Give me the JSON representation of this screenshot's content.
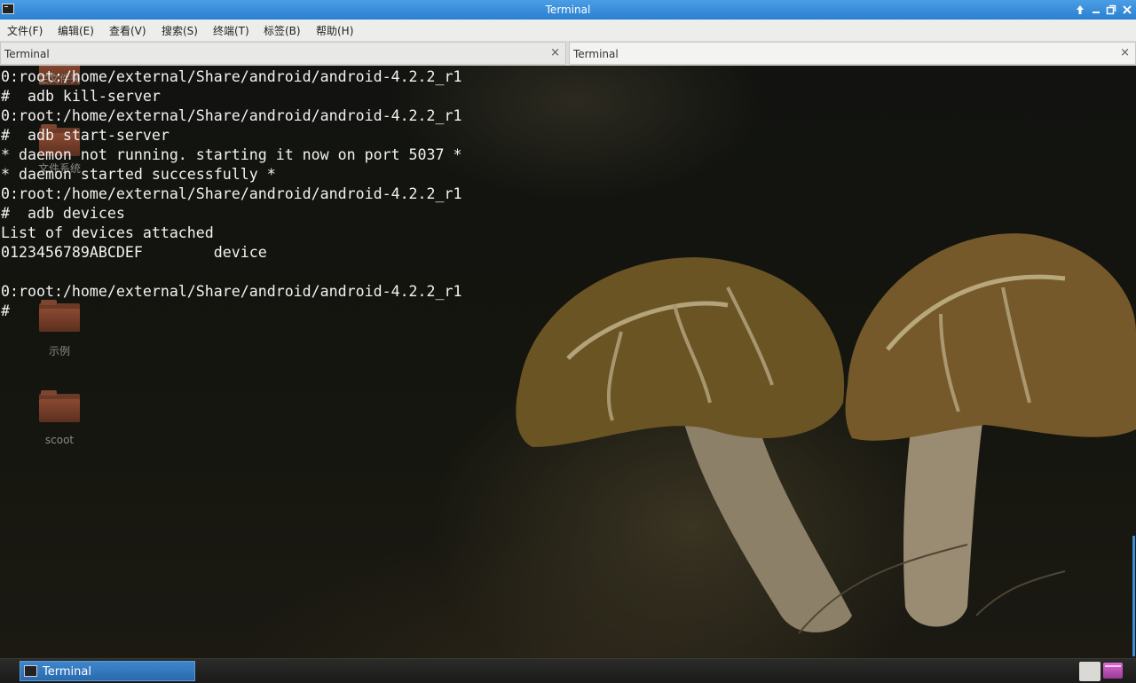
{
  "window": {
    "title": "Terminal"
  },
  "menu": {
    "items": [
      "文件(F)",
      "编辑(E)",
      "查看(V)",
      "搜索(S)",
      "终端(T)",
      "标签(B)",
      "帮助(H)"
    ]
  },
  "tabs": [
    {
      "label": "Terminal",
      "close": "×"
    },
    {
      "label": "Terminal",
      "close": "×"
    }
  ],
  "desktop": {
    "items": [
      {
        "label": "主文件夹",
        "icon": "folder-icon"
      },
      {
        "label": "文件系统",
        "icon": "folder-icon"
      },
      {
        "label": "示例",
        "icon": "folder-icon"
      },
      {
        "label": "scoot",
        "icon": "folder-icon"
      }
    ]
  },
  "terminal": {
    "lines": [
      "0:root:/home/external/Share/android/android-4.2.2_r1",
      "#  adb kill-server",
      "0:root:/home/external/Share/android/android-4.2.2_r1",
      "#  adb start-server",
      "* daemon not running. starting it now on port 5037 *",
      "* daemon started successfully *",
      "0:root:/home/external/Share/android/android-4.2.2_r1",
      "#  adb devices",
      "List of devices attached",
      "0123456789ABCDEF\tdevice",
      "",
      "0:root:/home/external/Share/android/android-4.2.2_r1",
      "#"
    ]
  },
  "taskbar": {
    "task_label": "Terminal"
  },
  "colors": {
    "titlebar": "#2a7fd0",
    "terminal_text": "#f2f2f2",
    "taskbar_active": "#2a6aae"
  }
}
